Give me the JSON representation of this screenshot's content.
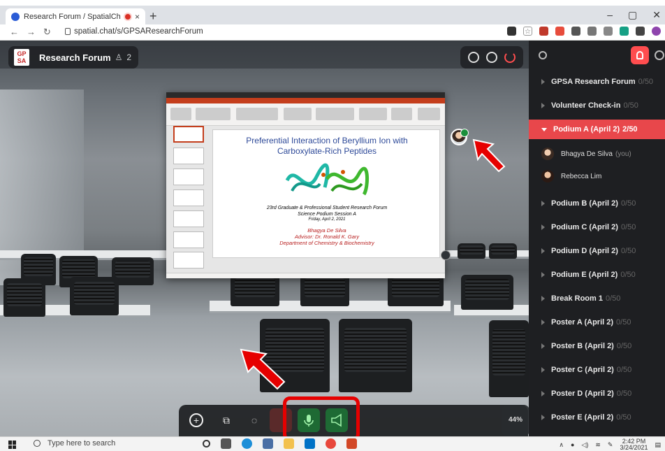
{
  "browser": {
    "tab_title": "Research Forum / SpatialCha",
    "tab_close": "×",
    "new_tab": "+",
    "url": "spatial.chat/s/GPSAResearchForum",
    "win_controls": [
      "–",
      "▢",
      "✕"
    ]
  },
  "topbar": {
    "logo_text": "GP SA",
    "room_name": "Research Forum",
    "participant_count": "2"
  },
  "slide": {
    "title_line1": "Preferential Interaction of Beryllium Ion with",
    "title_line2": "Carboxylate-Rich Peptides",
    "event_line1": "23rd Graduate & Professional Student Research Forum",
    "event_line2": "Science Podium Session A",
    "event_line3": "Friday, April 2, 2021",
    "author": "Bhagya De Silva",
    "advisor": "Advisor: Dr. Ronald K. Gary",
    "department": "Department of Chemistry & Biochemistry"
  },
  "toolbar": {
    "zoom": "44%"
  },
  "sidebar": {
    "rooms": [
      {
        "name": "GPSA Research Forum",
        "count": "0/50",
        "active": false
      },
      {
        "name": "Volunteer Check-in",
        "count": "0/50",
        "active": false
      },
      {
        "name": "Podium A (April 2)",
        "count": "2/50",
        "active": true
      },
      {
        "name": "Podium B (April 2)",
        "count": "0/50",
        "active": false
      },
      {
        "name": "Podium C (April 2)",
        "count": "0/50",
        "active": false
      },
      {
        "name": "Podium D (April 2)",
        "count": "0/50",
        "active": false
      },
      {
        "name": "Podium E (April 2)",
        "count": "0/50",
        "active": false
      },
      {
        "name": "Break Room 1",
        "count": "0/50",
        "active": false
      },
      {
        "name": "Poster A (April 2)",
        "count": "0/50",
        "active": false
      },
      {
        "name": "Poster B (April 2)",
        "count": "0/50",
        "active": false
      },
      {
        "name": "Poster C (April 2)",
        "count": "0/50",
        "active": false
      },
      {
        "name": "Poster D (April 2)",
        "count": "0/50",
        "active": false
      },
      {
        "name": "Poster E (April 2)",
        "count": "0/50",
        "active": false
      }
    ],
    "members": [
      {
        "name": "Bhagya De Silva",
        "tag": "(you)"
      },
      {
        "name": "Rebecca Lim",
        "tag": ""
      }
    ]
  },
  "taskbar": {
    "search_placeholder": "Type here to search",
    "time": "2:42 PM",
    "date": "3/24/2021"
  },
  "colors": {
    "accent": "#e8474b",
    "mic_green": "#1e6a34",
    "annotation_red": "#e60000"
  }
}
